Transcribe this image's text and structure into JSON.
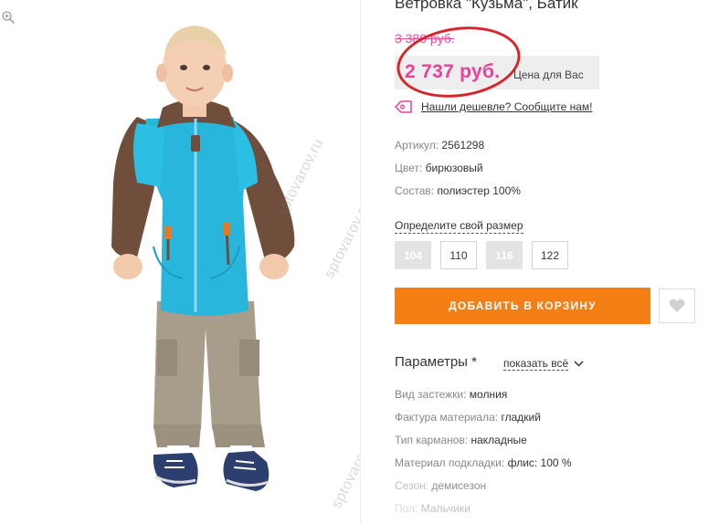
{
  "product": {
    "title": "Ветровка \"Кузьма\", Батик",
    "old_price": "3 380 руб.",
    "price": "2 737 руб.",
    "price_note": "Цена для Вас",
    "cheaper_link": "Нашли дешевле? Сообщите нам!",
    "watermark": "sptovarov.ru"
  },
  "attributes": [
    {
      "label": "Артикул:",
      "value": "2561298"
    },
    {
      "label": "Цвет:",
      "value": "бирюзовый"
    },
    {
      "label": "Состав:",
      "value": "полиэстер 100%"
    }
  ],
  "size_section": {
    "title": "Определите свой размер",
    "sizes": [
      {
        "label": "104",
        "available": false
      },
      {
        "label": "110",
        "available": true
      },
      {
        "label": "116",
        "available": false
      },
      {
        "label": "122",
        "available": true
      }
    ]
  },
  "actions": {
    "add_to_cart": "ДОБАВИТЬ В КОРЗИНУ",
    "favorite_icon": "heart-icon"
  },
  "parameters": {
    "title": "Параметры *",
    "show_all": "показать всё",
    "items": [
      {
        "label": "Вид застежки:",
        "value": "молния"
      },
      {
        "label": "Фактура материала:",
        "value": "гладкий"
      },
      {
        "label": "Тип карманов:",
        "value": "накладные"
      },
      {
        "label": "Материал подкладки:",
        "value": "флис: 100 %"
      },
      {
        "label": "Сезон:",
        "value": "демисезон"
      },
      {
        "label": "Пол:",
        "value": "Мальчики"
      }
    ]
  },
  "colors": {
    "accent_orange": "#f57f14",
    "price_pink": "#ee3f96",
    "annotation_red": "#d8252a"
  }
}
